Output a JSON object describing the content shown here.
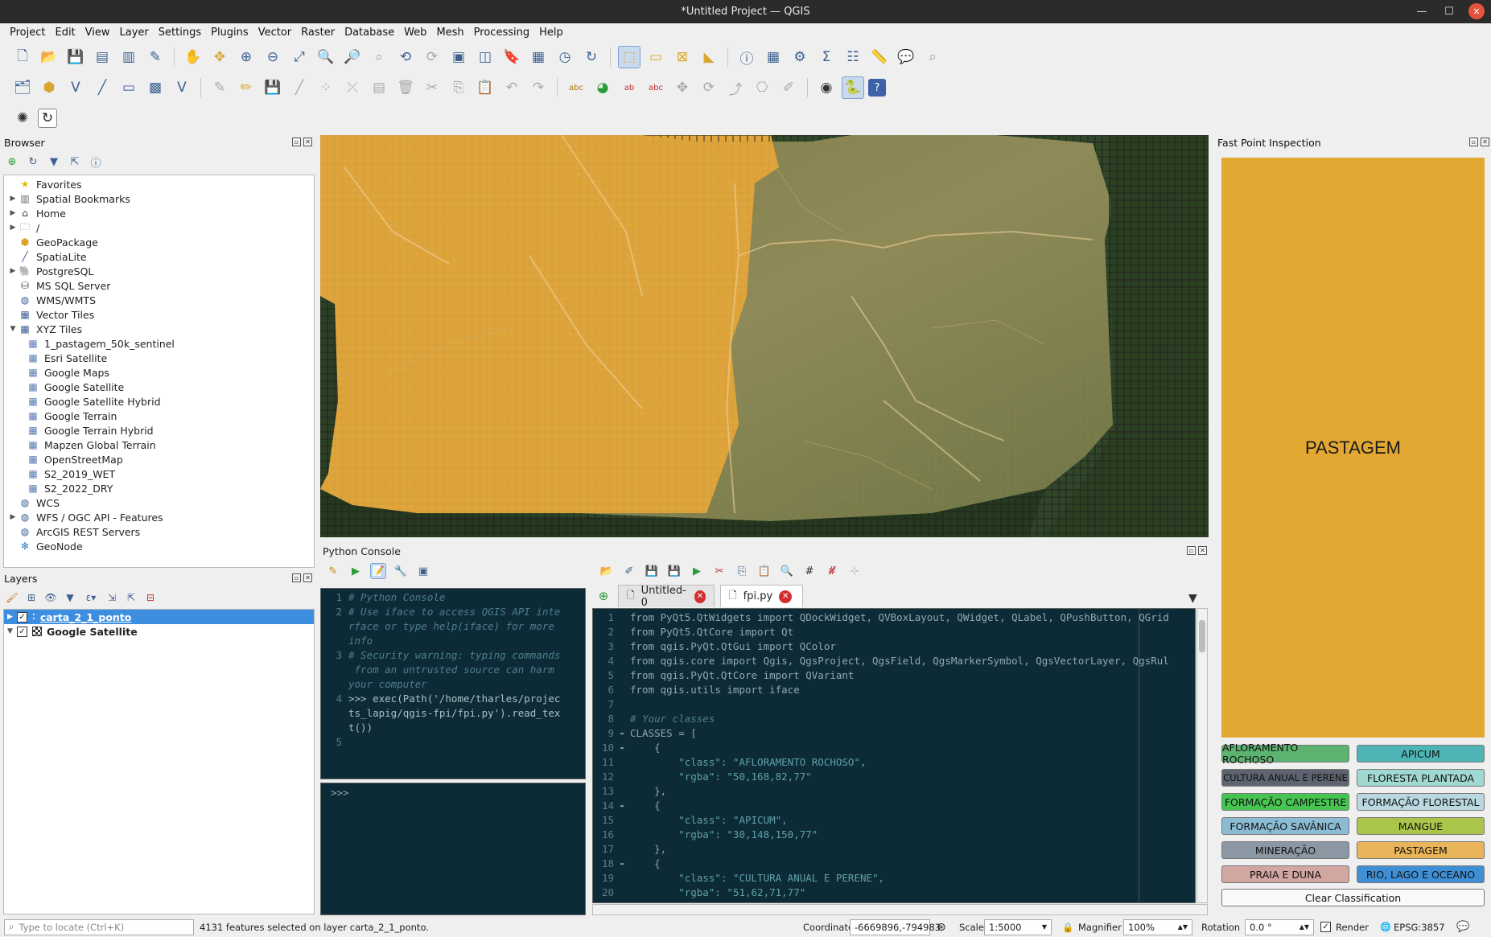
{
  "window": {
    "title": "*Untitled Project — QGIS"
  },
  "menu": [
    "Project",
    "Edit",
    "View",
    "Layer",
    "Settings",
    "Plugins",
    "Vector",
    "Raster",
    "Database",
    "Web",
    "Mesh",
    "Processing",
    "Help"
  ],
  "browser": {
    "title": "Browser",
    "items": [
      {
        "label": "Favorites",
        "icon": "star-icon",
        "arrow": "",
        "indent": 0
      },
      {
        "label": "Spatial Bookmarks",
        "icon": "bookmark-icon",
        "arrow": "▶",
        "indent": 0
      },
      {
        "label": "Home",
        "icon": "home-folder-icon",
        "arrow": "▶",
        "indent": 0
      },
      {
        "label": "/",
        "icon": "folder-icon",
        "arrow": "▶",
        "indent": 0
      },
      {
        "label": "GeoPackage",
        "icon": "geopackage-icon",
        "arrow": "",
        "indent": 0
      },
      {
        "label": "SpatiaLite",
        "icon": "spatialite-icon",
        "arrow": "",
        "indent": 0
      },
      {
        "label": "PostgreSQL",
        "icon": "postgresql-icon",
        "arrow": "▶",
        "indent": 0
      },
      {
        "label": "MS SQL Server",
        "icon": "mssql-icon",
        "arrow": "",
        "indent": 0
      },
      {
        "label": "WMS/WMTS",
        "icon": "globe-icon",
        "arrow": "",
        "indent": 0
      },
      {
        "label": "Vector Tiles",
        "icon": "vector-tiles-icon",
        "arrow": "",
        "indent": 0
      },
      {
        "label": "XYZ Tiles",
        "icon": "xyz-tiles-icon",
        "arrow": "▼",
        "indent": 0
      },
      {
        "label": "1_pastagem_50k_sentinel",
        "icon": "tile-layer-icon",
        "arrow": "",
        "indent": 1
      },
      {
        "label": "Esri Satellite",
        "icon": "tile-layer-icon",
        "arrow": "",
        "indent": 1
      },
      {
        "label": "Google Maps",
        "icon": "tile-layer-icon",
        "arrow": "",
        "indent": 1
      },
      {
        "label": "Google Satellite",
        "icon": "tile-layer-icon",
        "arrow": "",
        "indent": 1
      },
      {
        "label": "Google Satellite Hybrid",
        "icon": "tile-layer-icon",
        "arrow": "",
        "indent": 1
      },
      {
        "label": "Google Terrain",
        "icon": "tile-layer-icon",
        "arrow": "",
        "indent": 1
      },
      {
        "label": "Google Terrain Hybrid",
        "icon": "tile-layer-icon",
        "arrow": "",
        "indent": 1
      },
      {
        "label": "Mapzen Global Terrain",
        "icon": "tile-layer-icon",
        "arrow": "",
        "indent": 1
      },
      {
        "label": "OpenStreetMap",
        "icon": "tile-layer-icon",
        "arrow": "",
        "indent": 1
      },
      {
        "label": "S2_2019_WET",
        "icon": "tile-layer-icon",
        "arrow": "",
        "indent": 1
      },
      {
        "label": "S2_2022_DRY",
        "icon": "tile-layer-icon",
        "arrow": "",
        "indent": 1
      },
      {
        "label": "WCS",
        "icon": "globe-icon",
        "arrow": "",
        "indent": 0
      },
      {
        "label": "WFS / OGC API - Features",
        "icon": "globe-icon",
        "arrow": "▶",
        "indent": 0
      },
      {
        "label": "ArcGIS REST Servers",
        "icon": "globe-icon",
        "arrow": "",
        "indent": 0
      },
      {
        "label": "GeoNode",
        "icon": "geonode-icon",
        "arrow": "",
        "indent": 0
      }
    ]
  },
  "layers": {
    "title": "Layers",
    "items": [
      {
        "label": "carta_2_1_ponto",
        "selected": true
      },
      {
        "label": "Google Satellite",
        "selected": false
      }
    ]
  },
  "console": {
    "title": "Python Console",
    "lines": [
      {
        "n": "1",
        "text": "# Python Console"
      },
      {
        "n": "2",
        "text": "# Use iface to access QGIS API inte"
      },
      {
        "n": "",
        "text": "rface or type help(iface) for more"
      },
      {
        "n": "",
        "text": "info"
      },
      {
        "n": "3",
        "text": "# Security warning: typing commands"
      },
      {
        "n": "",
        "text": " from an untrusted source can harm"
      },
      {
        "n": "",
        "text": "your computer"
      },
      {
        "n": "4",
        "text": ">>> exec(Path('/home/tharles/projec"
      },
      {
        "n": "",
        "text": "ts_lapig/qgis-fpi/fpi.py').read_tex"
      },
      {
        "n": "",
        "text": "t())"
      },
      {
        "n": "5",
        "text": ""
      }
    ],
    "prompt": ">>>"
  },
  "editor": {
    "tabs": [
      {
        "label": "Untitled-0"
      },
      {
        "label": "fpi.py"
      }
    ],
    "lines": [
      "from PyQt5.QtWidgets import QDockWidget, QVBoxLayout, QWidget, QLabel, QPushButton, QGrid",
      "from PyQt5.QtCore import Qt",
      "from qgis.PyQt.QtGui import QColor",
      "from qgis.core import Qgis, QgsProject, QgsField, QgsMarkerSymbol, QgsVectorLayer, QgsRul",
      "from qgis.PyQt.QtCore import QVariant",
      "from qgis.utils import iface",
      "",
      "# Your classes",
      "CLASSES = [",
      "    {",
      "        \"class\": \"AFLORAMENTO ROCHOSO\",",
      "        \"rgba\": \"50,168,82,77\"",
      "    },",
      "    {",
      "        \"class\": \"APICUM\",",
      "        \"rgba\": \"30,148,150,77\"",
      "    },",
      "    {",
      "        \"class\": \"CULTURA ANUAL E PERENE\",",
      "        \"rgba\": \"51,62,71,77\""
    ]
  },
  "fpi": {
    "title": "Fast Point Inspection",
    "current_class": "PASTAGEM",
    "current_color": "#e3a832",
    "buttons": [
      {
        "label": "AFLORAMENTO ROCHOSO",
        "color": "#5cb26f"
      },
      {
        "label": "APICUM",
        "color": "#4fb4b6"
      },
      {
        "label": "CULTURA ANUAL E PERENE",
        "color": "#5d6470"
      },
      {
        "label": "FLORESTA PLANTADA",
        "color": "#9fd9d2"
      },
      {
        "label": "FORMAÇÃO CAMPESTRE",
        "color": "#46c552"
      },
      {
        "label": "FORMAÇÃO FLORESTAL",
        "color": "#b9d8e0"
      },
      {
        "label": "FORMAÇÃO SAVÂNICA",
        "color": "#8bbcd3"
      },
      {
        "label": "MANGUE",
        "color": "#a9c54a"
      },
      {
        "label": "MINERAÇÃO",
        "color": "#8b97a3"
      },
      {
        "label": "PASTAGEM",
        "color": "#e9b55a"
      },
      {
        "label": "PRAIA E DUNA",
        "color": "#d2a6a1"
      },
      {
        "label": "RIO, LAGO E OCEANO",
        "color": "#3f8fd6"
      }
    ],
    "clear_label": "Clear Classification"
  },
  "status": {
    "locate_placeholder": "Type to locate (Ctrl+K)",
    "message": "4131 features selected on layer carta_2_1_ponto.",
    "coordinate_label": "Coordinate",
    "coordinate": "-6669896,-794983",
    "scale_label": "Scale",
    "scale": "1:5000",
    "magnifier_label": "Magnifier",
    "magnifier": "100%",
    "rotation_label": "Rotation",
    "rotation": "0.0 °",
    "render_label": "Render",
    "crs": "EPSG:3857"
  }
}
